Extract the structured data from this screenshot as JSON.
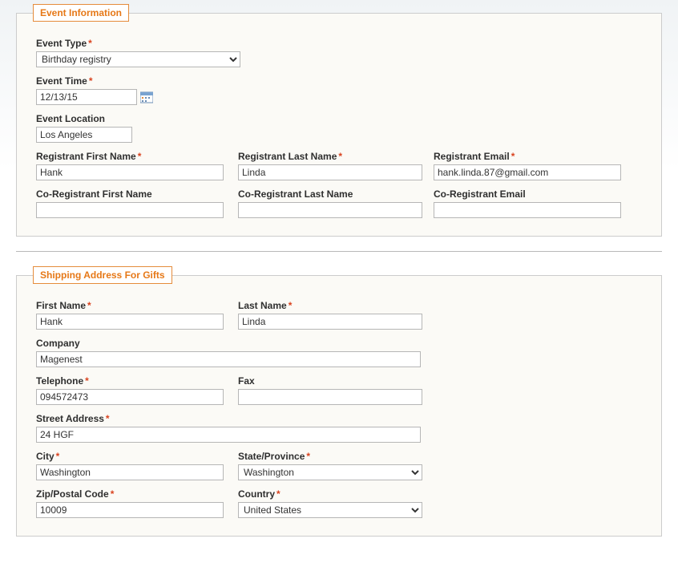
{
  "event": {
    "legend": "Event Information",
    "type_label": "Event Type",
    "type_value": "Birthday registry",
    "time_label": "Event Time",
    "time_value": "12/13/15",
    "location_label": "Event Location",
    "location_value": "Los Angeles",
    "reg_first_label": "Registrant First Name",
    "reg_first_value": "Hank",
    "reg_last_label": "Registrant Last Name",
    "reg_last_value": "Linda",
    "reg_email_label": "Registrant Email",
    "reg_email_value": "hank.linda.87@gmail.com",
    "co_first_label": "Co-Registrant First Name",
    "co_first_value": "",
    "co_last_label": "Co-Registrant Last Name",
    "co_last_value": "",
    "co_email_label": "Co-Registrant Email",
    "co_email_value": ""
  },
  "ship": {
    "legend": "Shipping Address For Gifts",
    "first_label": "First Name",
    "first_value": "Hank",
    "last_label": "Last Name",
    "last_value": "Linda",
    "company_label": "Company",
    "company_value": "Magenest",
    "telephone_label": "Telephone",
    "telephone_value": "094572473",
    "fax_label": "Fax",
    "fax_value": "",
    "street_label": "Street Address",
    "street_value": "24 HGF",
    "city_label": "City",
    "city_value": "Washington",
    "state_label": "State/Province",
    "state_value": "Washington",
    "zip_label": "Zip/Postal Code",
    "zip_value": "10009",
    "country_label": "Country",
    "country_value": "United States"
  }
}
